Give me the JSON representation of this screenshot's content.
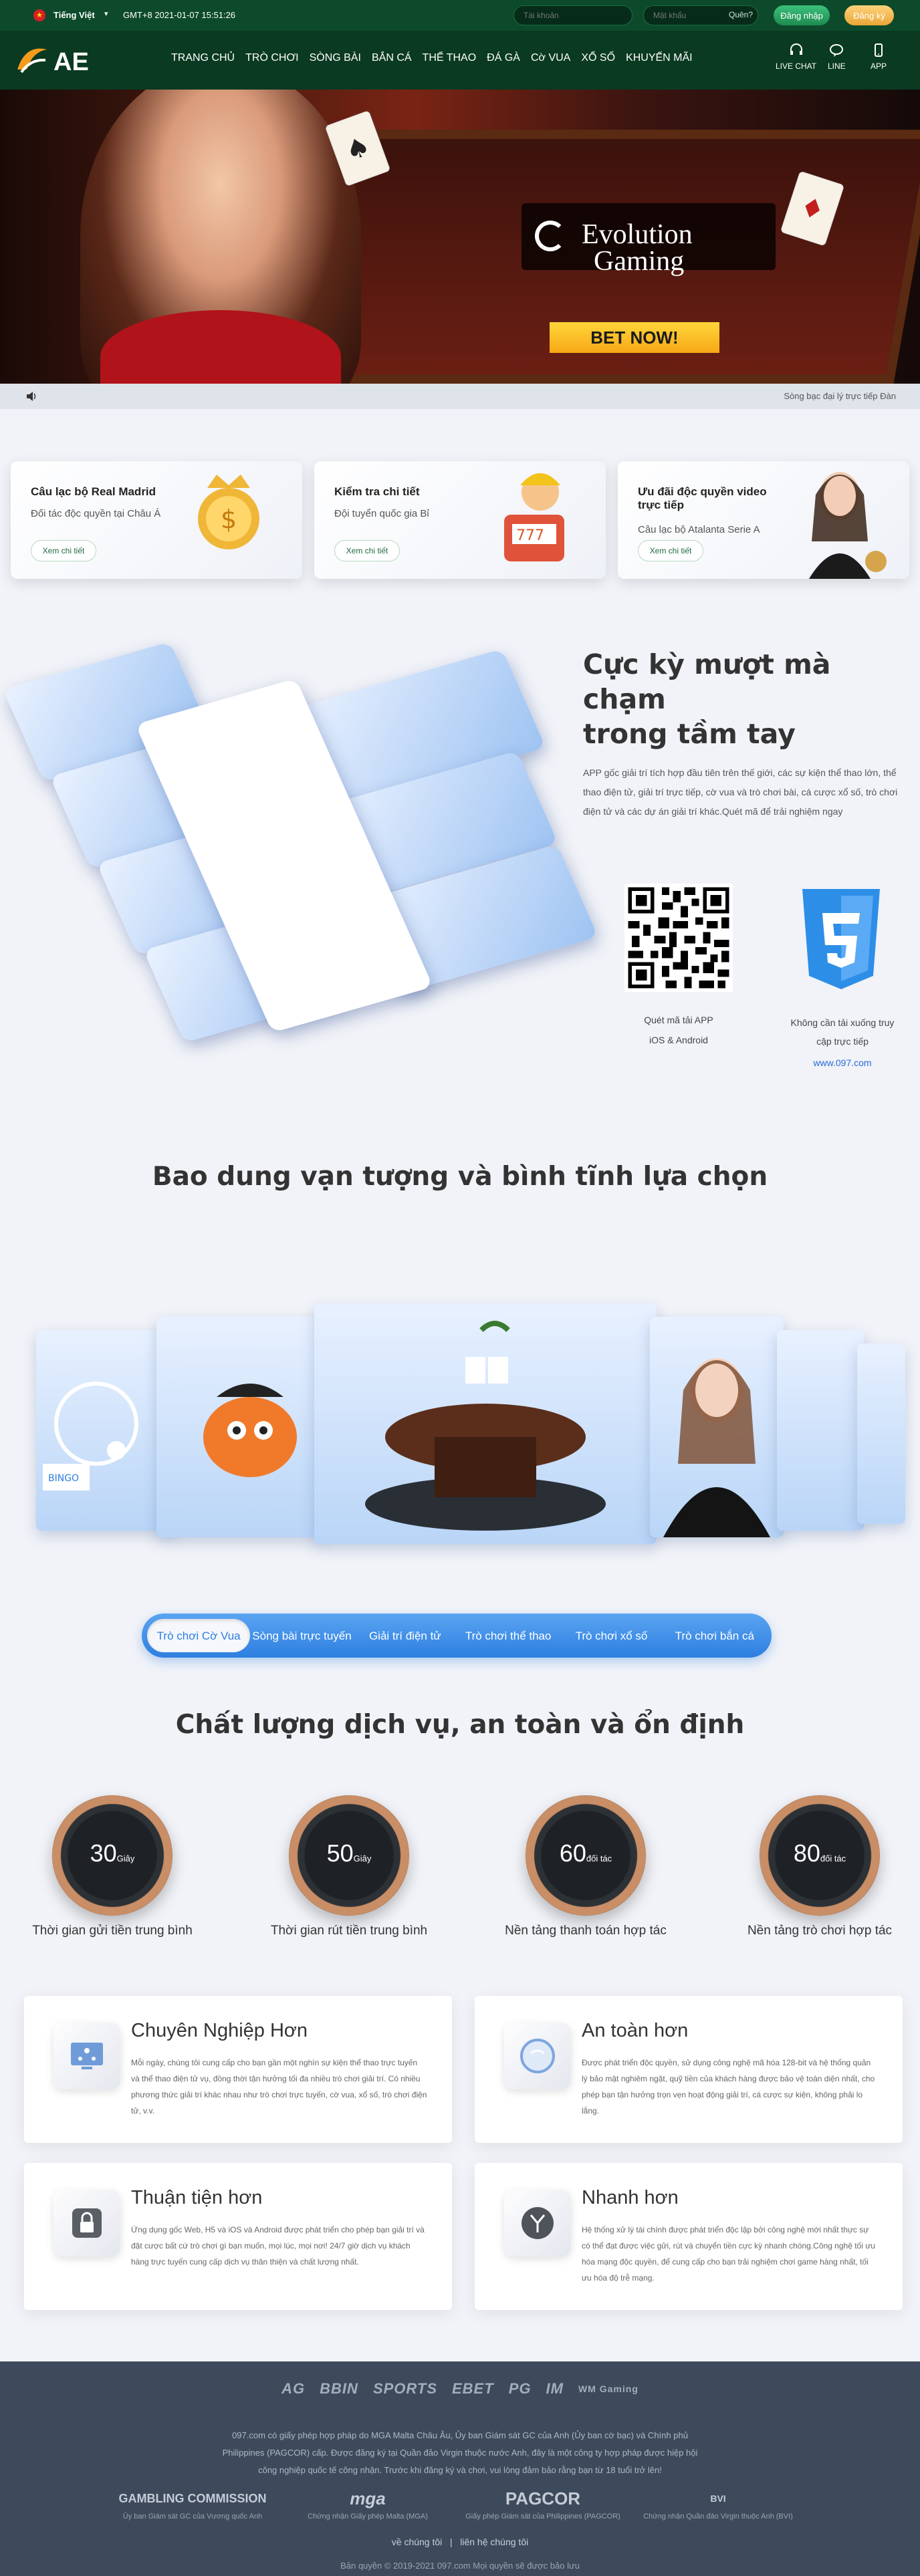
{
  "topbar": {
    "language": "Tiếng Việt",
    "clock": "GMT+8 2021-01-07 15:51:26",
    "username_placeholder": "Tài khoản",
    "password_placeholder": "Mật khẩu",
    "forgot": "Quên?",
    "login": "Đăng nhập",
    "register": "Đăng ký"
  },
  "nav": {
    "logo": "AE",
    "items": [
      "TRANG CHỦ",
      "TRÒ CHƠI",
      "SÒNG BÀI",
      "BẮN CÁ",
      "THỂ THAO",
      "ĐÁ GÀ",
      "Cờ VUA",
      "XỔ SỐ",
      "KHUYẾN MÃI"
    ],
    "tools": [
      "LIVE CHAT",
      "LINE",
      "APP"
    ]
  },
  "banner": {
    "brand_line1": "Evolution",
    "brand_line2": "Gaming",
    "cta": "BET NOW!"
  },
  "ticker": {
    "text": "Sòng bạc đại lý trực tiếp Đàn"
  },
  "promos": [
    {
      "title": "Câu lạc bộ Real Madrid",
      "subtitle": "Đối tác độc quyền tại Châu Á",
      "button": "Xem chi tiết"
    },
    {
      "title": "Kiểm tra chi tiết",
      "subtitle": "Đội tuyển quốc gia Bỉ",
      "button": "Xem chi tiết"
    },
    {
      "title": "Ưu đãi độc quyền video trực tiếp",
      "subtitle": "Câu lạc bộ Atalanta Serie A",
      "button": "Xem chi tiết"
    }
  ],
  "app": {
    "title_line1": "Cực kỳ mượt mà chạm",
    "title_line2": "trong tầm tay",
    "description": "APP gốc giải trí tích hợp đầu tiên trên thế giới, các sự kiện thể thao lớn, thể thao điện tử, giải trí trực tiếp, cờ vua và trò chơi bài, cá cược xổ số, trò chơi điện tử và các dự án giải trí khác.Quét mã để trải nghiệm ngay",
    "qr_caption_1": "Quét mã tải APP",
    "qr_caption_2": "iOS & Android",
    "h5_caption_1": "Không cần tải xuống truy",
    "h5_caption_2": "cập trực tiếp",
    "h5_url": "www.097.com"
  },
  "games": {
    "title": "Bao dung vạn tượng và bình tĩnh lựa chọn",
    "tabs": [
      "Trò chơi Cờ Vua",
      "Sòng bài trực tuyến",
      "Giải trí điện tử",
      "Trò chơi thể thao",
      "Trò chơi xổ số",
      "Trò chơi bắn cá"
    ]
  },
  "quality": {
    "title": "Chất lượng dịch vụ, an toàn và ổn định",
    "stats": [
      {
        "value": "30",
        "unit": "Giây",
        "label": "Thời gian gửi tiền trung bình"
      },
      {
        "value": "50",
        "unit": "Giây",
        "label": "Thời gian rút tiền trung bình"
      },
      {
        "value": "60",
        "unit": "đối tác",
        "label": "Nền tảng thanh toán hợp tác"
      },
      {
        "value": "80",
        "unit": "đối tác",
        "label": "Nền tảng trò chơi hợp tác"
      }
    ]
  },
  "features": [
    {
      "title": "Chuyên Nghiệp Hơn",
      "text": "Mỗi ngày, chúng tôi cung cấp cho bạn gần một nghìn sự kiện thể thao trực tuyến và thể thao điện tử vụ, đồng thời tận hưởng tối đa nhiều trò chơi giải trí. Có nhiều phương thức giải trí khác nhau như trò chơi trực tuyến, cờ vua, xổ số, trò chơi điện tử, v.v."
    },
    {
      "title": "An toàn hơn",
      "text": "Được phát triển độc quyền, sử dụng công nghệ mã hóa 128-bit và hệ thống quản lý bảo mật nghiêm ngặt, quỹ tiền của khách hàng được bảo vệ toàn diện nhất, cho phép bạn tận hưởng trọn vẹn hoạt động giải trí, cá cược sự kiện, không phải lo lắng."
    },
    {
      "title": "Thuận tiện hơn",
      "text": "Ứng dụng gốc Web, H5 và iOS và Android được phát triển cho phép bạn giải trí và đặt cược bất cứ trò chơi gì bạn muốn, mọi lúc, mọi nơi! 24/7 giờ dịch vụ khách hàng trực tuyến cung cấp dịch vụ thân thiện và chất lượng nhất."
    },
    {
      "title": "Nhanh hơn",
      "text": "Hệ thống xử lý tài chính được phát triển độc lập bởi công nghệ mới nhất thực sự có thể đạt được việc gửi, rút và chuyển tiền cực kỳ nhanh chóng.Công nghệ tối ưu hóa mạng độc quyền, để cung cấp cho bạn trải nghiệm chơi game hàng nhất, tối ưu hóa độ trễ mạng."
    }
  ],
  "footer": {
    "partners": [
      "AG",
      "BBIN",
      "SPORTS",
      "EBET",
      "PG",
      "IM",
      "WM Gaming"
    ],
    "text_lines": [
      "097.com có giấy phép hợp pháp do MGA Malta Châu Âu, Ủy ban Giám sát GC của Anh (Ủy ban cờ bạc) và Chính phủ",
      "Philippines (PAGCOR) cấp. Được đăng ký tại Quần đảo Virgin thuộc nước Anh, đây là một công ty hợp pháp được hiệp hội",
      "công nghiệp quốc tế công nhận. Trước khi đăng ký và chơi, vui lòng đảm bảo rằng bạn từ 18 tuổi trở lên!"
    ],
    "licenses": [
      {
        "name": "GAMBLING COMMISSION",
        "caption": "Ủy ban Giám sát GC của Vương quốc Anh"
      },
      {
        "name": "mga",
        "caption": "Chứng nhận Giấy phép Malta (MGA)"
      },
      {
        "name": "PAGCOR",
        "caption": "Giấy phép Giám sát của Philippines (PAGCOR)"
      },
      {
        "name": "BVI",
        "caption": "Chứng nhận Quần đảo Virgin thuộc Anh (BVI)"
      }
    ],
    "links": [
      "về chúng tôi",
      "liên hệ chúng tôi"
    ],
    "copyright": "Bản quyền © 2019-2021 097.com Mọi quyền sẽ được bảo lưu"
  },
  "colors": {
    "header": "#0a3a22",
    "accent_blue": "#2d7fe0",
    "cta_yellow": "#f7a816",
    "footer": "#3d4a5b"
  }
}
